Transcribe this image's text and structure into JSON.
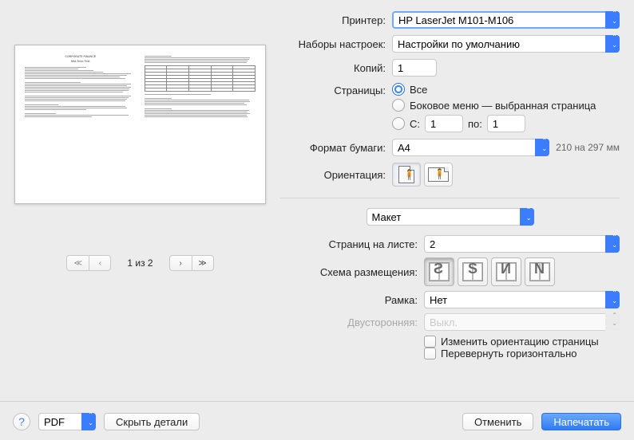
{
  "labels": {
    "printer": "Принтер:",
    "presets": "Наборы настроек:",
    "copies": "Копий:",
    "pages": "Страницы:",
    "all": "Все",
    "side_menu": "Боковое меню — выбранная страница",
    "from": "С:",
    "to": "по:",
    "paper_size": "Формат бумаги:",
    "orientation": "Ориентация:",
    "pages_per_sheet": "Страниц на листе:",
    "layout_direction": "Схема размещения:",
    "border": "Рамка:",
    "two_sided": "Двусторонняя:",
    "reverse_orientation": "Изменить ориентацию страницы",
    "flip_horiz": "Перевернуть горизонтально",
    "page_counter": "1 из 2"
  },
  "values": {
    "printer": "HP LaserJet M101-M106",
    "presets": "Настройки по умолчанию",
    "copies": "1",
    "from": "1",
    "to": "1",
    "paper_size": "A4",
    "paper_size_note": "210 на 297 мм",
    "section": "Макет",
    "pages_per_sheet": "2",
    "border": "Нет",
    "two_sided": "Выкл."
  },
  "footer": {
    "pdf": "PDF",
    "hide_details": "Скрыть детали",
    "cancel": "Отменить",
    "print": "Напечатать"
  }
}
